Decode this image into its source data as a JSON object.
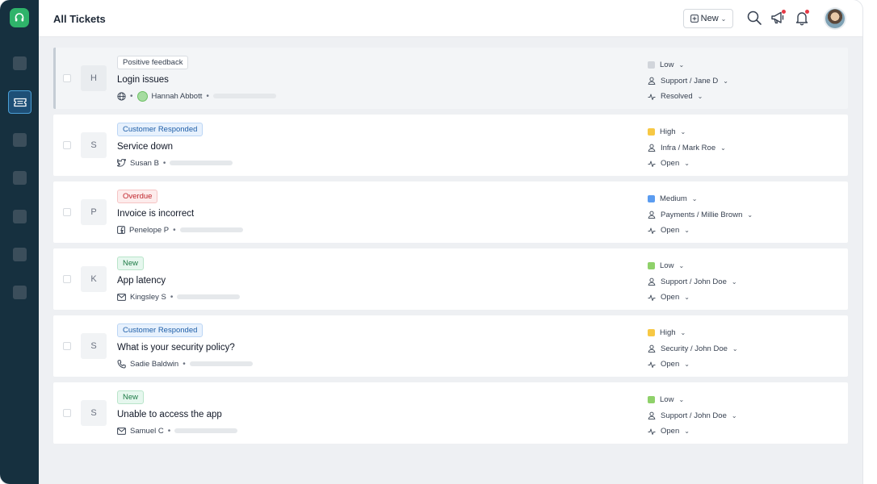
{
  "header": {
    "title": "All Tickets",
    "new_label": "New"
  },
  "sidebar": {
    "items": [
      "logo-icon",
      "nav-item",
      "tickets-icon",
      "nav-item",
      "nav-item",
      "nav-item",
      "nav-item",
      "nav-item"
    ]
  },
  "colors": {
    "sidebar_bg": "#16303f",
    "brand": "#2fb36a",
    "priority_low": "#8fd16a",
    "priority_high": "#f7c844",
    "priority_medium": "#5b9cf0",
    "priority_low_grey": "#d1d5db"
  },
  "tickets": [
    {
      "initial": "H",
      "tag": "Positive feedback",
      "subject": "Login issues",
      "requester": "Hannah Abbott",
      "channel": "globe-icon",
      "priority": "Low",
      "group": "Support / Jane D",
      "status": "Resolved"
    },
    {
      "initial": "S",
      "tag": "Customer Responded",
      "subject": "Service down",
      "requester": "Susan B",
      "channel": "twitter-icon",
      "priority": "High",
      "group": "Infra / Mark Roe",
      "status": "Open"
    },
    {
      "initial": "P",
      "tag": "Overdue",
      "subject": "Invoice is incorrect",
      "requester": "Penelope P",
      "channel": "facebook-icon",
      "priority": "Medium",
      "group": "Payments / Millie Brown",
      "status": "Open"
    },
    {
      "initial": "K",
      "tag": "New",
      "subject": "App latency",
      "requester": "Kingsley S",
      "channel": "email-icon",
      "priority": "Low",
      "group": "Support / John Doe",
      "status": "Open"
    },
    {
      "initial": "S",
      "tag": "Customer Responded",
      "subject": "What is your security policy?",
      "requester": "Sadie Baldwin",
      "channel": "phone-icon",
      "priority": "High",
      "group": "Security / John Doe",
      "status": "Open"
    },
    {
      "initial": "S",
      "tag": "New",
      "subject": "Unable to access the app",
      "requester": "Samuel C",
      "channel": "email-icon",
      "priority": "Low",
      "group": "Support / John Doe",
      "status": "Open"
    }
  ]
}
